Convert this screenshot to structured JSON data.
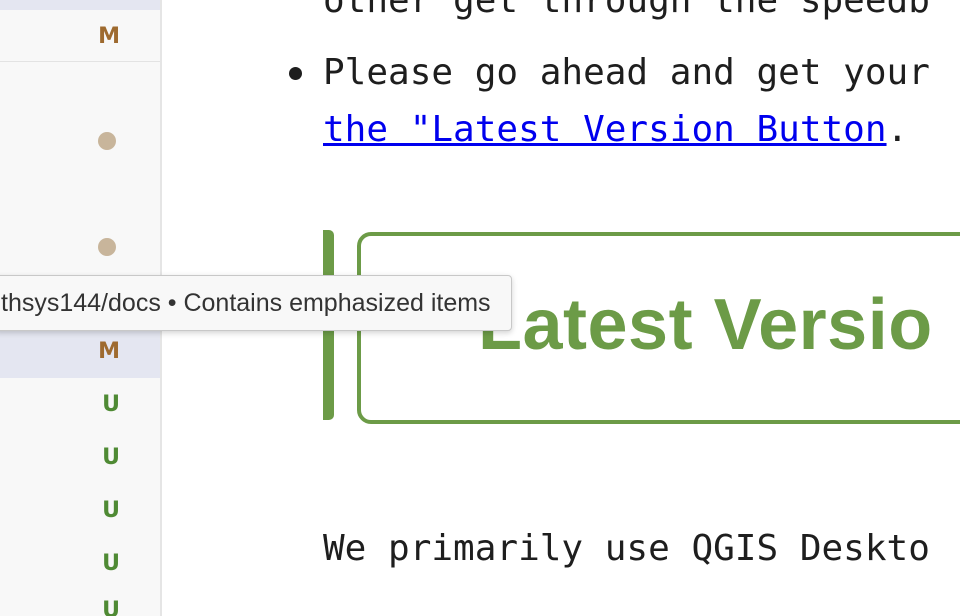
{
  "sidebar": {
    "rows": [
      {
        "badge": "M"
      },
      {
        "badge": ""
      },
      {
        "badge": ""
      },
      {
        "badge": "M"
      },
      {
        "badge": "U"
      },
      {
        "badge": "U"
      },
      {
        "badge": "U"
      },
      {
        "badge": "U"
      },
      {
        "badge": "U"
      }
    ]
  },
  "tooltip": {
    "text": "thsys144/docs • Contains emphasized items"
  },
  "preview": {
    "cut_line": "other get through the speedb",
    "bullet_text": "Please go ahead and get your",
    "link_text": "the \"Latest Version Button",
    "link_suffix": ".",
    "button_image_text": "Latest Versio",
    "paragraph": "We primarily use QGIS Deskto"
  },
  "colors": {
    "modified": "#9e6a2f",
    "untracked": "#4f8a34",
    "selected_row": "#e4e6f1",
    "link": "#0000ee",
    "button_green": "#6c9b47"
  }
}
